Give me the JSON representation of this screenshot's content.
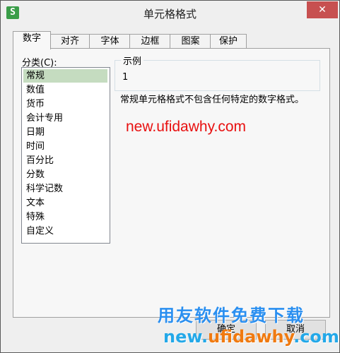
{
  "window": {
    "icon_glyph": "S",
    "title": "单元格格式",
    "close_glyph": "✕"
  },
  "tabs": [
    {
      "label": "数字",
      "active": true
    },
    {
      "label": "对齐"
    },
    {
      "label": "字体"
    },
    {
      "label": "边框"
    },
    {
      "label": "图案"
    },
    {
      "label": "保护"
    }
  ],
  "category": {
    "label": "分类(C):",
    "items": [
      "常规",
      "数值",
      "货币",
      "会计专用",
      "日期",
      "时间",
      "百分比",
      "分数",
      "科学记数",
      "文本",
      "特殊",
      "自定义"
    ],
    "selected": "常规"
  },
  "sample": {
    "legend": "示例",
    "value": "1"
  },
  "description": "常规单元格格式不包含任何特定的数字格式。",
  "buttons": {
    "ok": "确定",
    "cancel": "取消"
  },
  "watermarks": {
    "url": "new.ufidawhy.com",
    "brand": "用友软件免费下载",
    "domain_left": "new.",
    "domain_mid": "ufidawhy",
    "domain_right": ".com"
  },
  "colors": {
    "selection": "#c5dcc0",
    "url_red": "#e81010",
    "brand_blue": "#2a8ff0",
    "domain_orange": "#f07a10",
    "close_red": "#c75050",
    "icon_green": "#3a9d48"
  }
}
